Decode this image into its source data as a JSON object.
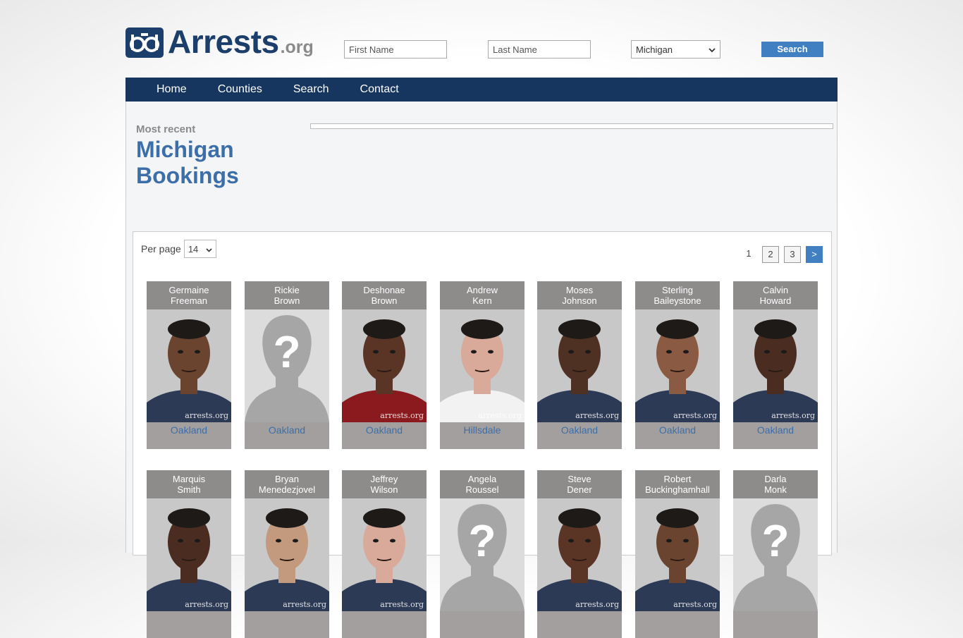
{
  "header": {
    "logo_text": "Arrests",
    "logo_tld": ".org",
    "first_name_placeholder": "First Name",
    "last_name_placeholder": "Last Name",
    "state_selected": "Michigan",
    "search_label": "Search"
  },
  "nav": [
    "Home",
    "Counties",
    "Search",
    "Contact"
  ],
  "page": {
    "kicker": "Most recent",
    "title_line1": "Michigan",
    "title_line2": "Bookings"
  },
  "list": {
    "per_page_label": "Per page",
    "per_page_value": "14",
    "pages": [
      "1",
      "2",
      "3"
    ],
    "next_label": ">",
    "watermark": "arrests.org",
    "people": [
      {
        "first": "Germaine",
        "last": "Freeman",
        "county": "Oakland",
        "photo": "mugshot",
        "skin": "#6b4430",
        "shirt": "#2d3a55"
      },
      {
        "first": "Rickie",
        "last": "Brown",
        "county": "Oakland",
        "photo": "placeholder",
        "skin": "#c9c9c9",
        "shirt": "#c9c9c9"
      },
      {
        "first": "Deshonae",
        "last": "Brown",
        "county": "Oakland",
        "photo": "mugshot",
        "skin": "#5a3526",
        "shirt": "#8a1a1e"
      },
      {
        "first": "Andrew",
        "last": "Kern",
        "county": "Hillsdale",
        "photo": "mugshot",
        "skin": "#d9a99a",
        "shirt": "#f2f2f2"
      },
      {
        "first": "Moses",
        "last": "Johnson",
        "county": "Oakland",
        "photo": "mugshot",
        "skin": "#4f3124",
        "shirt": "#2d3a55"
      },
      {
        "first": "Sterling",
        "last": "Baileystone",
        "county": "Oakland",
        "photo": "mugshot",
        "skin": "#8a5a42",
        "shirt": "#2d3a55"
      },
      {
        "first": "Calvin",
        "last": "Howard",
        "county": "Oakland",
        "photo": "mugshot",
        "skin": "#4a2c20",
        "shirt": "#2d3a55"
      },
      {
        "first": "Marquis",
        "last": "Smith",
        "county": "",
        "photo": "mugshot",
        "skin": "#4a2c20",
        "shirt": "#2d3a55"
      },
      {
        "first": "Bryan",
        "last": "Menedezjovel",
        "county": "",
        "photo": "mugshot",
        "skin": "#c49a7e",
        "shirt": "#2d3a55"
      },
      {
        "first": "Jeffrey",
        "last": "Wilson",
        "county": "",
        "photo": "mugshot",
        "skin": "#d9a99a",
        "shirt": "#2d3a55"
      },
      {
        "first": "Angela",
        "last": "Roussel",
        "county": "",
        "photo": "placeholder",
        "skin": "#c9c9c9",
        "shirt": "#c9c9c9"
      },
      {
        "first": "Steve",
        "last": "Dener",
        "county": "",
        "photo": "mugshot",
        "skin": "#5a3526",
        "shirt": "#2d3a55"
      },
      {
        "first": "Robert",
        "last": "Buckinghamhall",
        "county": "",
        "photo": "mugshot",
        "skin": "#6b4430",
        "shirt": "#2d3a55"
      },
      {
        "first": "Darla",
        "last": "Monk",
        "county": "",
        "photo": "placeholder",
        "skin": "#c9c9c9",
        "shirt": "#c9c9c9"
      }
    ]
  }
}
